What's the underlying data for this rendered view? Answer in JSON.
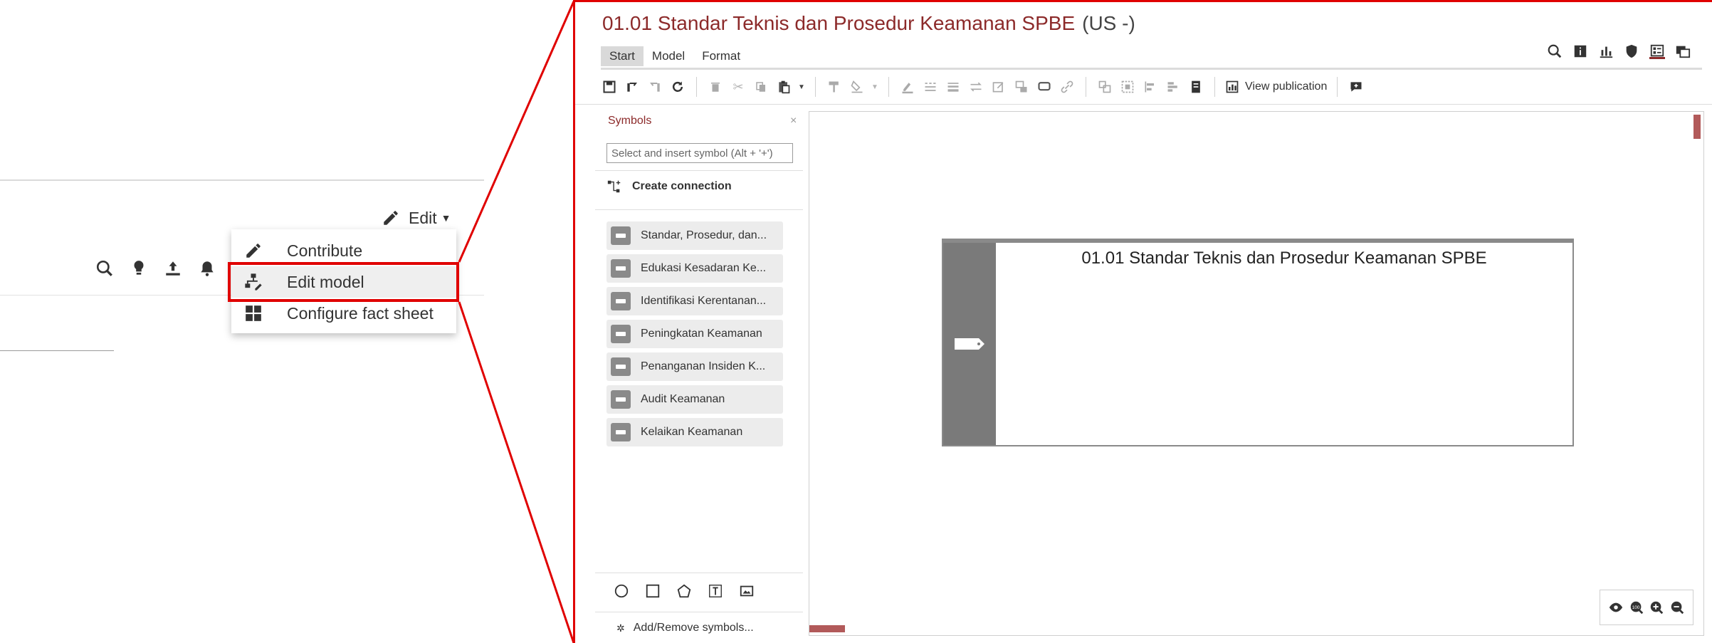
{
  "left_page": {
    "edit_label": "Edit",
    "menu": [
      {
        "label": "Contribute",
        "icon": "pencil-icon"
      },
      {
        "label": "Edit model",
        "icon": "edit-model-icon",
        "highlighted": true
      },
      {
        "label": "Configure fact sheet",
        "icon": "grid-icon"
      }
    ],
    "icons": [
      "search-icon",
      "lightbulb-icon",
      "upload-icon",
      "bell-icon",
      "print-icon"
    ]
  },
  "app": {
    "title": "01.01 Standar Teknis dan Prosedur Keamanan SPBE",
    "language": "(US",
    "language_caret": "-)",
    "tabs": [
      "Start",
      "Model",
      "Format"
    ],
    "active_tab": "Start",
    "view_publication_label": "View publication",
    "symbols": {
      "header": "Symbols",
      "close": "×",
      "search_placeholder": "Select and insert symbol (Alt + '+')",
      "create_connection": "Create connection",
      "items": [
        "Standar, Prosedur, dan...",
        "Edukasi Kesadaran Ke...",
        "Identifikasi Kerentanan...",
        "Peningkatan Keamanan",
        "Penanganan Insiden K...",
        "Audit Keamanan",
        "Kelaikan Keamanan"
      ],
      "add_remove": "Add/Remove symbols..."
    },
    "canvas": {
      "object_title": "01.01 Standar Teknis dan Prosedur Keamanan SPBE"
    }
  },
  "colors": {
    "accent": "#8c2a2a",
    "highlight_box": "#e00000",
    "scrollbar": "#b25a5a",
    "object_side": "#7a7a7a"
  }
}
